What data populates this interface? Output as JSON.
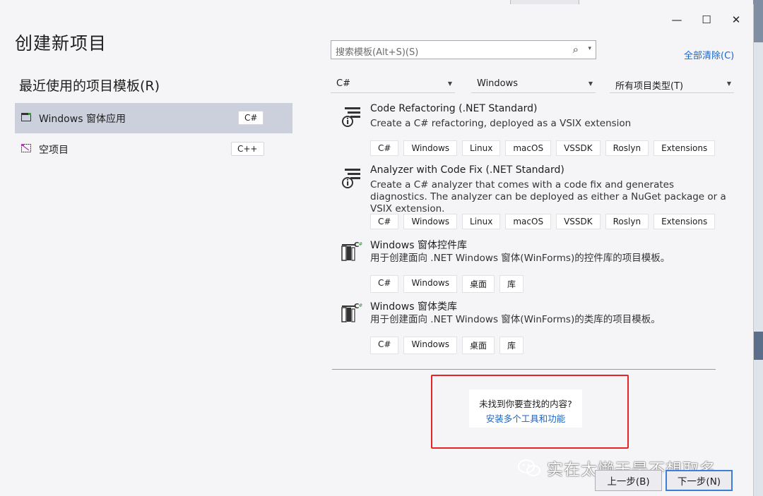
{
  "window": {
    "minimize_glyph": "—",
    "maximize_glyph": "☐",
    "close_glyph": "✕"
  },
  "header": {
    "title": "创建新项目"
  },
  "recent": {
    "title": "最近使用的项目模板(R)",
    "items": [
      {
        "name": "Windows 窗体应用",
        "lang": "C#",
        "icon": "winforms-app-icon"
      },
      {
        "name": "空项目",
        "lang": "C++",
        "icon": "empty-project-icon"
      }
    ]
  },
  "search": {
    "placeholder": "搜索模板(Alt+S)(S)",
    "icon": "search-icon",
    "dropdown": "▾"
  },
  "clear_all": "全部清除(C)",
  "filters": [
    {
      "value": "C#"
    },
    {
      "value": "Windows"
    },
    {
      "value": "所有项目类型(T)"
    }
  ],
  "templates": [
    {
      "name": "Code Refactoring (.NET Standard)",
      "desc": "Create a C# refactoring, deployed as a VSIX extension",
      "icon": "refactoring-icon",
      "tags": [
        "C#",
        "Windows",
        "Linux",
        "macOS",
        "VSSDK",
        "Roslyn",
        "Extensions"
      ]
    },
    {
      "name": "Analyzer with Code Fix (.NET Standard)",
      "desc": "Create a C# analyzer that comes with a code fix and generates diagnostics. The analyzer can be deployed as either a NuGet package or a VSIX extension.",
      "icon": "analyzer-icon",
      "tags": [
        "C#",
        "Windows",
        "Linux",
        "macOS",
        "VSSDK",
        "Roslyn",
        "Extensions"
      ]
    },
    {
      "name": "Windows 窗体控件库",
      "desc": "用于创建面向 .NET Windows 窗体(WinForms)的控件库的项目模板。",
      "icon": "control-library-icon",
      "tags": [
        "C#",
        "Windows",
        "桌面",
        "库"
      ]
    },
    {
      "name": "Windows 窗体类库",
      "desc": "用于创建面向 .NET Windows 窗体(WinForms)的类库的项目模板。",
      "icon": "class-library-icon",
      "tags": [
        "C#",
        "Windows",
        "桌面",
        "库"
      ]
    }
  ],
  "not_found": {
    "question": "未找到你要查找的内容?",
    "link": "安装多个工具和功能"
  },
  "watermark": "实在太懒于是不想取名",
  "buttons": {
    "back": "上一步(B)",
    "next": "下一步(N)"
  },
  "colors": {
    "accent_link": "#1a66c9",
    "highlight_box": "#e62424",
    "selected_row": "#ccd0dc"
  }
}
